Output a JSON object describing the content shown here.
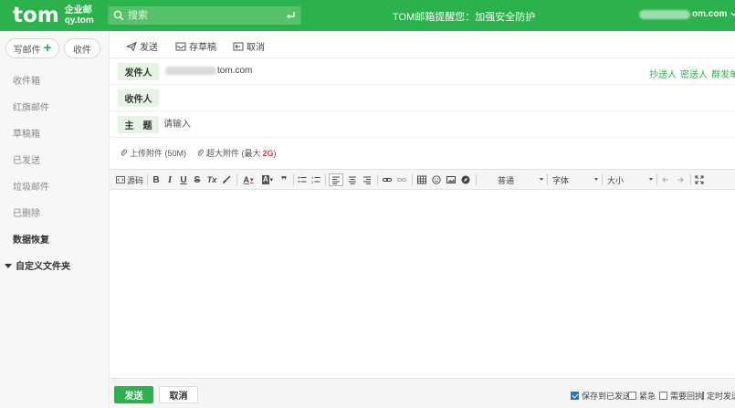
{
  "topbar": {
    "logo_main": "tom",
    "logo_sub_cn": "企业邮",
    "logo_sub_en": "qy.tom",
    "search_placeholder": "搜索",
    "notice": "TOM邮箱提醒您：加强安全防护",
    "account_suffix": "om.com"
  },
  "sidebar": {
    "compose_label": "写邮件",
    "receive_label": "收件",
    "folders": [
      "收件箱",
      "红旗邮件",
      "草稿箱",
      "已发送",
      "垃圾邮件",
      "已删除",
      "数据恢复"
    ],
    "custom_folder": "自定义文件夹"
  },
  "actions": {
    "send": "发送",
    "save_draft": "存草稿",
    "cancel": "取消"
  },
  "compose": {
    "from_label": "发件人",
    "from_value_suffix": "tom.com",
    "to_label": "收件人",
    "subject_label": "主　题",
    "subject_placeholder": "请输入",
    "cc_links": [
      "抄送人",
      "密送人",
      "群发单显"
    ]
  },
  "attachments": {
    "upload": "上传附件 (50M)",
    "large_prefix": "超大附件 (最大",
    "large_size": "2G",
    "large_suffix": ")"
  },
  "editor_toolbar": {
    "source": "源码",
    "bold": "B",
    "italic": "I",
    "underline": "U",
    "strike": "S",
    "clear": "Tx",
    "font_color": "A",
    "bg_color": "A",
    "quote": "❞",
    "paragraph": "普通",
    "font": "字体",
    "size": "大小"
  },
  "bottom": {
    "send": "发送",
    "cancel": "取消",
    "options": [
      {
        "label": "保存到已发送",
        "checked": true
      },
      {
        "label": "紧急",
        "checked": false
      },
      {
        "label": "需要回执",
        "checked": false
      },
      {
        "label": "定时发送",
        "checked": false
      }
    ]
  },
  "colors": {
    "brand_green": "#2bb24c",
    "label_bg": "#e6f4e4",
    "accent_red": "#e53935",
    "checkbox_blue": "#1e73e8"
  }
}
